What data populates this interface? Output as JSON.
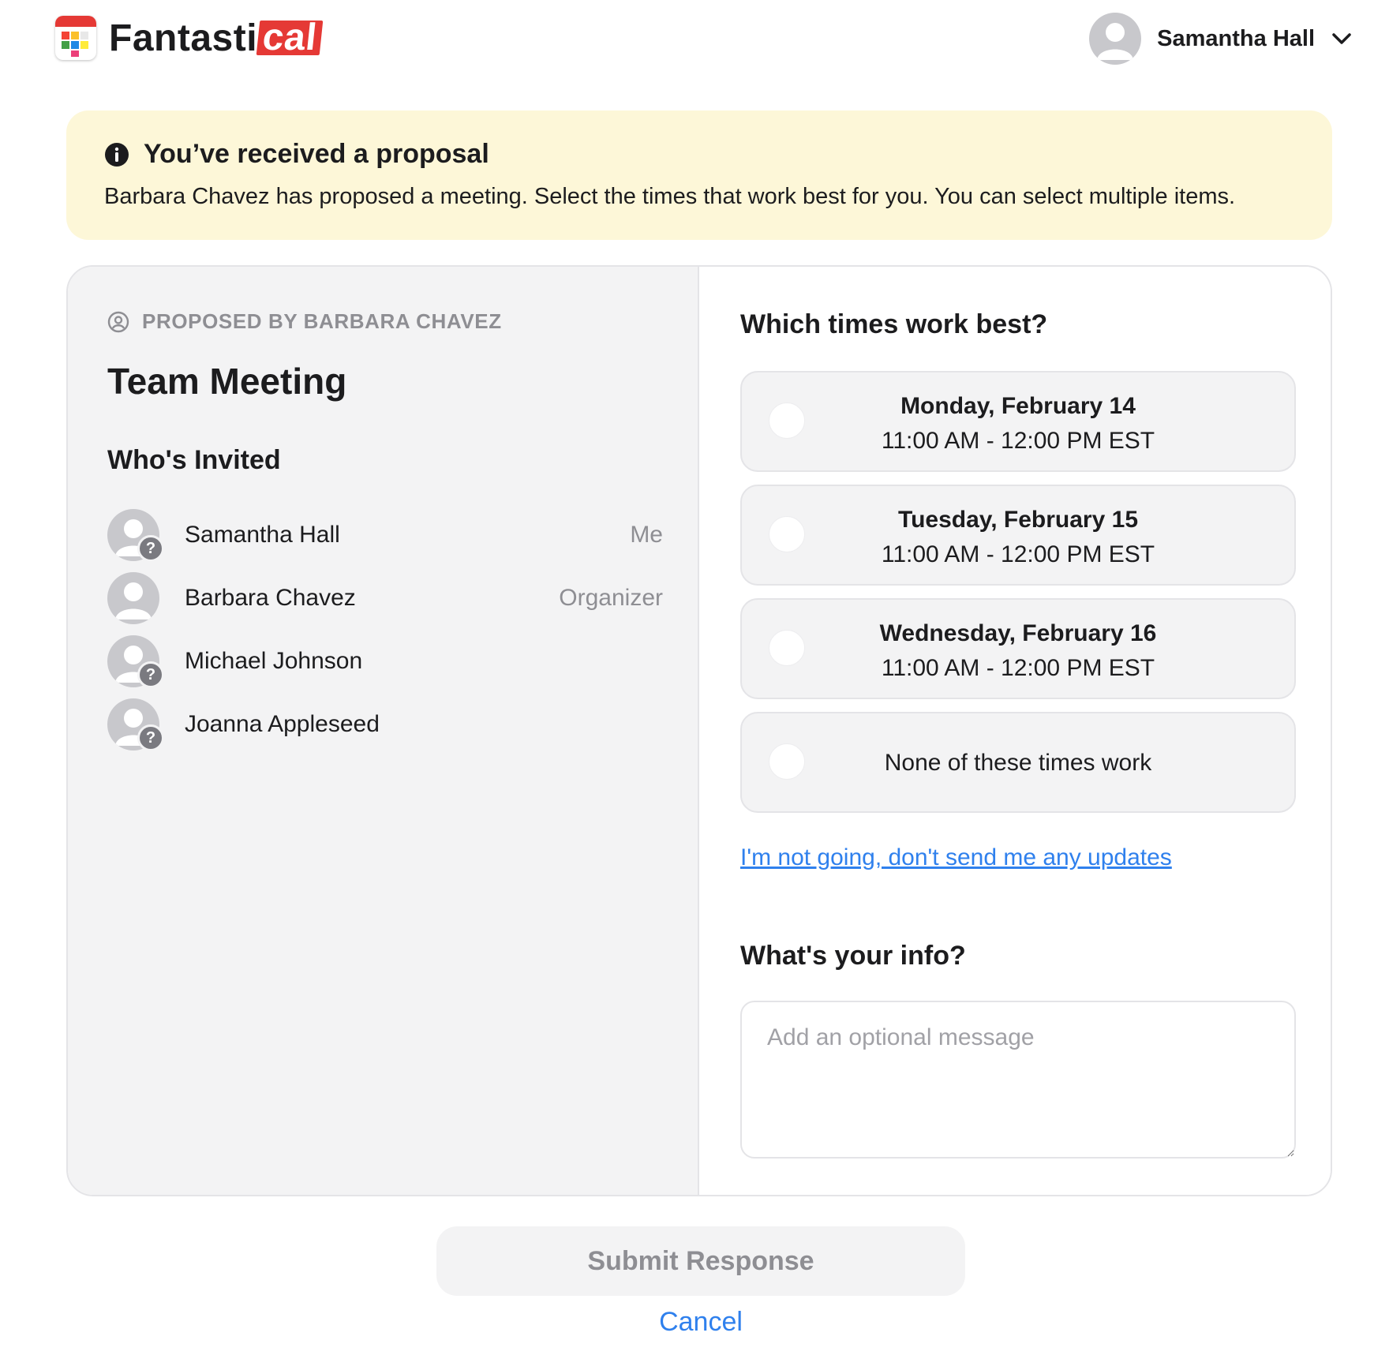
{
  "header": {
    "logo_text": "Fantasti",
    "logo_accent": "cal",
    "user_name": "Samantha Hall",
    "avatar_icon": "user-avatar-icon",
    "menu_icon": "chevron-down-icon"
  },
  "banner": {
    "icon": "info-icon",
    "title": "You’ve received a proposal",
    "text": "Barbara Chavez has proposed a meeting. Select the times that work best for you. You can select multiple items."
  },
  "event": {
    "proposed_by": "PROPOSED BY BARBARA CHAVEZ",
    "title": "Team Meeting",
    "invited_heading": "Who's Invited",
    "attendees": [
      {
        "name": "Samantha Hall",
        "role": "Me",
        "status_icon": "question-badge-icon"
      },
      {
        "name": "Barbara Chavez",
        "role": "Organizer",
        "status_icon": ""
      },
      {
        "name": "Michael Johnson",
        "role": "",
        "status_icon": "question-badge-icon"
      },
      {
        "name": "Joanna Appleseed",
        "role": "",
        "status_icon": "question-badge-icon"
      }
    ]
  },
  "times": {
    "heading": "Which times work best?",
    "options": [
      {
        "day": "Monday, February 14",
        "time": "11:00 AM - 12:00 PM EST",
        "selected": false
      },
      {
        "day": "Tuesday, February 15",
        "time": "11:00 AM - 12:00 PM EST",
        "selected": false
      },
      {
        "day": "Wednesday, February 16",
        "time": "11:00 AM - 12:00 PM EST",
        "selected": false
      }
    ],
    "none_option": "None of these times work",
    "not_going_link": "I'm not going, don't send me any updates"
  },
  "info": {
    "heading": "What's your info?",
    "message_placeholder": "Add an optional message",
    "message_value": ""
  },
  "actions": {
    "submit_label": "Submit Response",
    "cancel_label": "Cancel"
  },
  "colors": {
    "brand_red": "#e53935",
    "banner_bg": "#fdf7d8",
    "link_blue": "#2f80ed",
    "panel_gray": "#f3f3f4"
  }
}
